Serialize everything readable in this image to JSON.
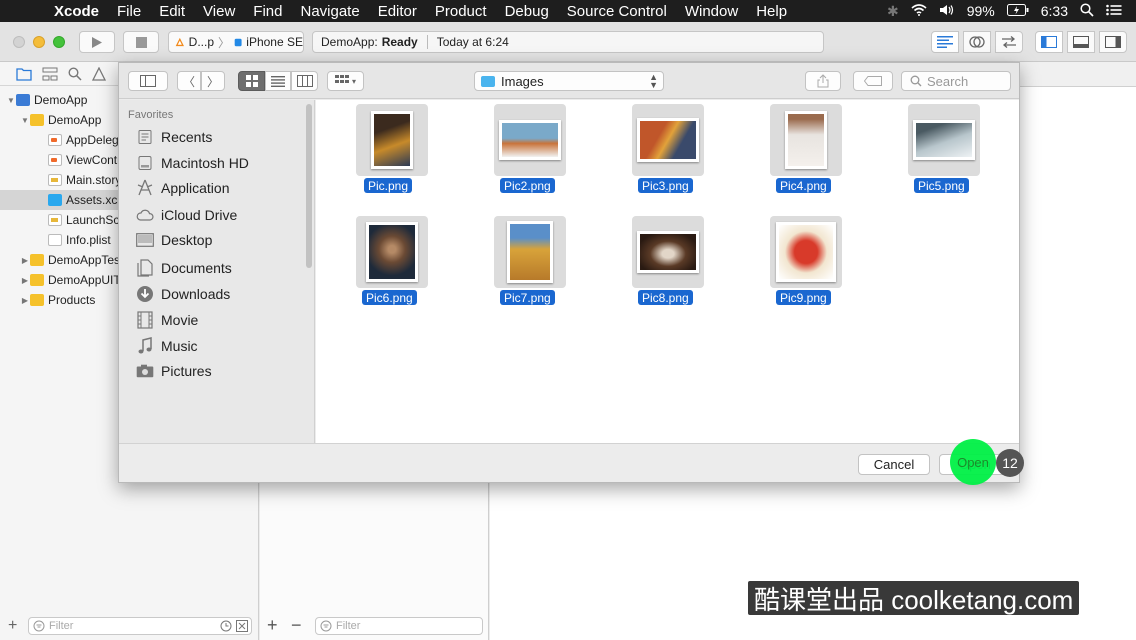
{
  "menubar": {
    "app_name": "Xcode",
    "items": [
      "File",
      "Edit",
      "View",
      "Find",
      "Navigate",
      "Editor",
      "Product",
      "Debug",
      "Source Control",
      "Window",
      "Help"
    ],
    "battery": "99%",
    "time": "6:33"
  },
  "toolbar": {
    "scheme_target": "D...p",
    "device": "iPhone SE",
    "activity_prefix": "DemoApp:",
    "activity_status": "Ready",
    "activity_time": "Today at 6:24"
  },
  "navigator": {
    "rows": [
      {
        "label": "DemoApp",
        "icon": "project-icon",
        "disclosure": "▼"
      },
      {
        "label": "DemoApp",
        "icon": "folder-icon",
        "disclosure": "▼"
      },
      {
        "label": "AppDelegate.swift",
        "icon": "swift-file-icon",
        "disclosure": ""
      },
      {
        "label": "ViewController.swift",
        "icon": "swift-file-icon",
        "disclosure": ""
      },
      {
        "label": "Main.storyboard",
        "icon": "storyboard-file-icon",
        "disclosure": ""
      },
      {
        "label": "Assets.xcassets",
        "icon": "asset-folder-icon",
        "disclosure": ""
      },
      {
        "label": "LaunchScreen.storyboard",
        "icon": "storyboard-file-icon",
        "disclosure": ""
      },
      {
        "label": "Info.plist",
        "icon": "plist-file-icon",
        "disclosure": ""
      },
      {
        "label": "DemoAppTests",
        "icon": "folder-icon",
        "disclosure": "▶"
      },
      {
        "label": "DemoAppUITests",
        "icon": "folder-icon",
        "disclosure": "▶"
      },
      {
        "label": "Products",
        "icon": "folder-icon",
        "disclosure": "▶"
      }
    ],
    "filter_placeholder": "Filter"
  },
  "editor": {
    "filter_placeholder": "Filter",
    "add_label": "+",
    "remove_label": "−"
  },
  "dialog": {
    "location": "Images",
    "search_placeholder": "Search",
    "favorites_header": "Favorites",
    "favorites": [
      {
        "label": "Recents",
        "icon": "recents-icon"
      },
      {
        "label": "Macintosh HD",
        "icon": "disk-icon"
      },
      {
        "label": "Application",
        "icon": "applications-icon"
      },
      {
        "label": "iCloud Drive",
        "icon": "cloud-icon"
      },
      {
        "label": "Desktop",
        "icon": "desktop-icon"
      },
      {
        "label": "Documents",
        "icon": "documents-icon"
      },
      {
        "label": "Downloads",
        "icon": "downloads-icon"
      },
      {
        "label": "Movie",
        "icon": "movie-icon"
      },
      {
        "label": "Music",
        "icon": "music-icon"
      },
      {
        "label": "Pictures",
        "icon": "pictures-icon"
      }
    ],
    "files": [
      {
        "name": "Pic.png",
        "colors": [
          "#3b2a1e",
          "#c78a2a"
        ]
      },
      {
        "name": "Pic2.png",
        "colors": [
          "#7aa9c9",
          "#c9733a"
        ]
      },
      {
        "name": "Pic3.png",
        "colors": [
          "#c0562a",
          "#3a4a6b"
        ]
      },
      {
        "name": "Pic4.png",
        "colors": [
          "#e8e4e0",
          "#9a6b4e"
        ]
      },
      {
        "name": "Pic5.png",
        "colors": [
          "#b8c6cc",
          "#4a5a62"
        ]
      },
      {
        "name": "Pic6.png",
        "colors": [
          "#6b4a34",
          "#1e2a3a"
        ]
      },
      {
        "name": "Pic7.png",
        "colors": [
          "#d8a33a",
          "#5a8fc9"
        ]
      },
      {
        "name": "Pic8.png",
        "colors": [
          "#5a3a26",
          "#e2d6c8"
        ]
      },
      {
        "name": "Pic9.png",
        "colors": [
          "#d83a2a",
          "#f2e6d0"
        ]
      }
    ],
    "cancel_label": "Cancel",
    "open_label": "Open"
  },
  "overlay": {
    "step_number": "12",
    "watermark": "酷课堂出品 coolketang.com"
  }
}
